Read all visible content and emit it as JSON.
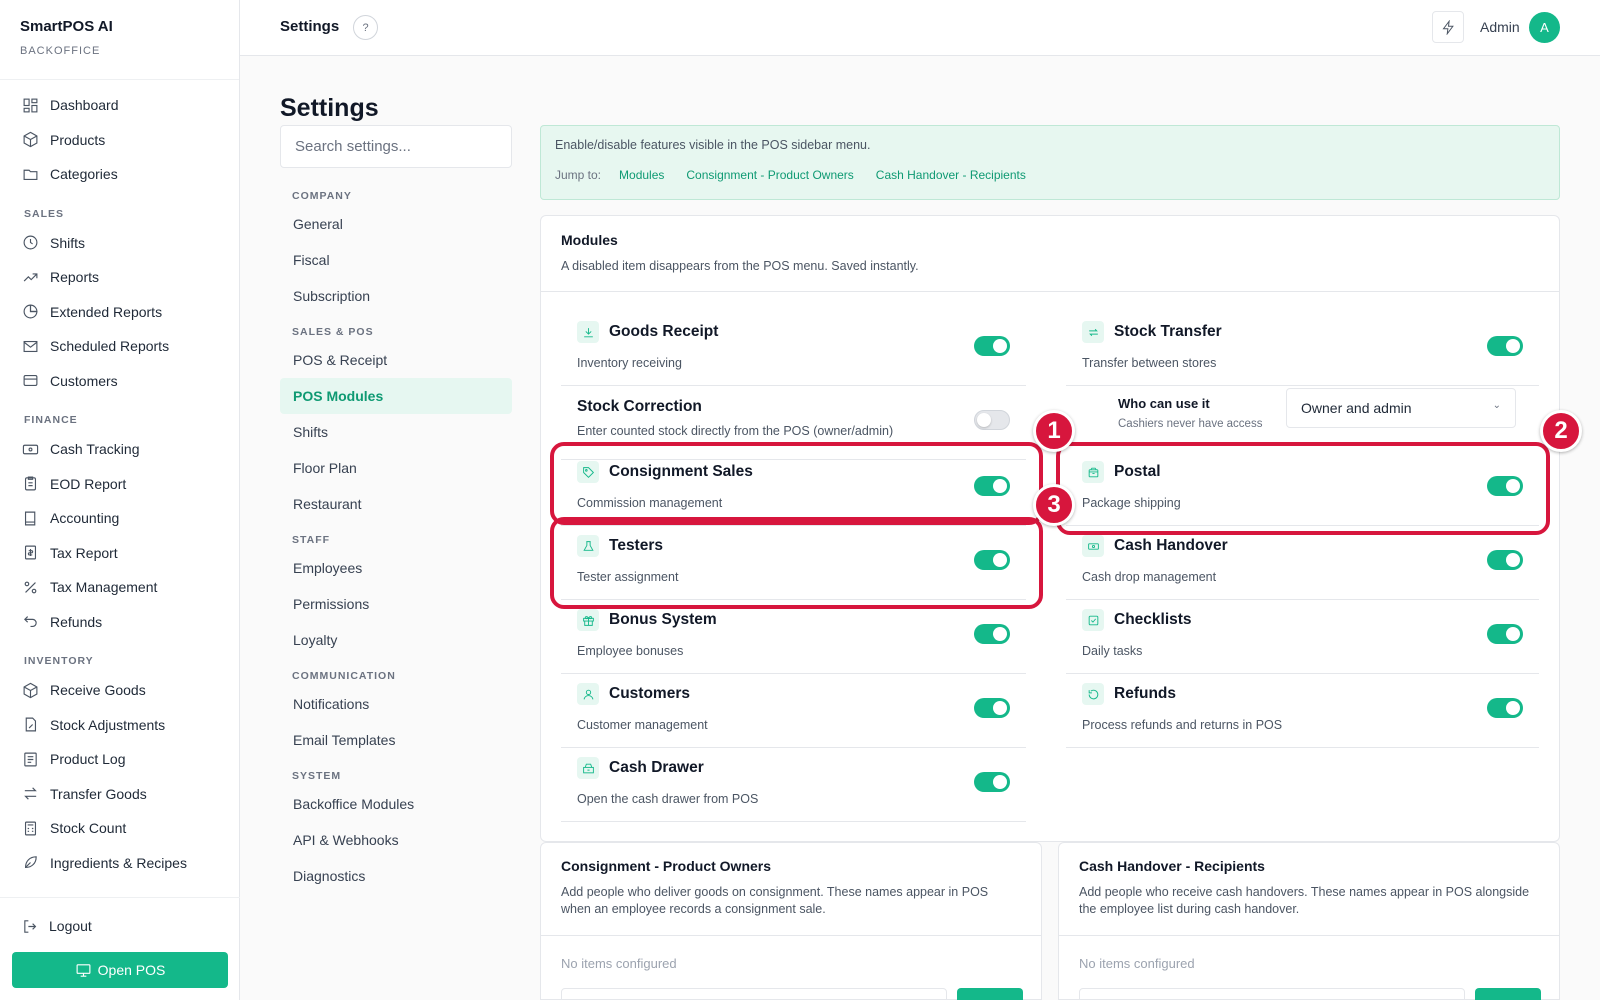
{
  "brand": {
    "name": "SmartPOS AI",
    "sub": "BACKOFFICE"
  },
  "nav": {
    "top": [
      "Dashboard",
      "Products",
      "Categories"
    ],
    "sales_title": "SALES",
    "sales": [
      "Shifts",
      "Reports",
      "Extended Reports",
      "Scheduled Reports",
      "Customers"
    ],
    "finance_title": "FINANCE",
    "finance": [
      "Cash Tracking",
      "EOD Report",
      "Accounting",
      "Tax Report",
      "Tax Management",
      "Refunds"
    ],
    "inventory_title": "INVENTORY",
    "inventory": [
      "Receive Goods",
      "Stock Adjustments",
      "Product Log",
      "Transfer Goods",
      "Stock Count",
      "Ingredients & Recipes"
    ],
    "logout": "Logout",
    "open_pos": "Open POS"
  },
  "topbar": {
    "title": "Settings",
    "help": "?",
    "user": "Admin",
    "avatar": "A"
  },
  "settings": {
    "title": "Settings",
    "search_placeholder": "Search settings...",
    "company_title": "COMPANY",
    "company": [
      "General",
      "Fiscal",
      "Subscription"
    ],
    "sales_pos_title": "SALES & POS",
    "sales_pos": [
      "POS & Receipt",
      "POS Modules",
      "Shifts",
      "Floor Plan",
      "Restaurant"
    ],
    "staff_title": "STAFF",
    "staff": [
      "Employees",
      "Permissions",
      "Loyalty"
    ],
    "communication_title": "COMMUNICATION",
    "communication": [
      "Notifications",
      "Email Templates"
    ],
    "system_title": "SYSTEM",
    "system": [
      "Backoffice Modules",
      "API & Webhooks",
      "Diagnostics"
    ]
  },
  "banner": {
    "text": "Enable/disable features visible in the POS sidebar menu.",
    "jump_label": "Jump to:",
    "links": [
      "Modules",
      "Consignment - Product Owners",
      "Cash Handover - Recipients"
    ]
  },
  "modules": {
    "title": "Modules",
    "subtitle": "A disabled item disappears from the POS menu. Saved instantly.",
    "left": [
      {
        "title": "Goods Receipt",
        "desc": "Inventory receiving",
        "icon": "download-icon",
        "on": true
      },
      {
        "title": "Stock Correction",
        "desc": "Enter counted stock directly from the POS (owner/admin)",
        "icon": "",
        "on": false
      },
      {
        "title": "Consignment Sales",
        "desc": "Commission management",
        "icon": "tag-icon",
        "on": true
      },
      {
        "title": "Testers",
        "desc": "Tester assignment",
        "icon": "flask-icon",
        "on": true
      },
      {
        "title": "Bonus System",
        "desc": "Employee bonuses",
        "icon": "gift-icon",
        "on": true
      },
      {
        "title": "Customers",
        "desc": "Customer management",
        "icon": "user-icon",
        "on": true
      },
      {
        "title": "Cash Drawer",
        "desc": "Open the cash drawer from POS",
        "icon": "drawer-icon",
        "on": true
      }
    ],
    "right": [
      {
        "title": "Stock Transfer",
        "desc": "Transfer between stores",
        "icon": "transfer-icon",
        "on": true
      },
      {
        "title": "Postal",
        "desc": "Package shipping",
        "icon": "package-icon",
        "on": true
      },
      {
        "title": "Cash Handover",
        "desc": "Cash drop management",
        "icon": "cash-icon",
        "on": true
      },
      {
        "title": "Checklists",
        "desc": "Daily tasks",
        "icon": "checklist-icon",
        "on": true
      },
      {
        "title": "Refunds",
        "desc": "Process refunds and returns in POS",
        "icon": "refund-icon",
        "on": true
      }
    ],
    "who": {
      "label": "Who can use it",
      "desc": "Cashiers never have access",
      "value": "Owner and admin"
    }
  },
  "consignment": {
    "title": "Consignment - Product Owners",
    "desc": "Add people who deliver goods on consignment. These names appear in POS when an employee records a consignment sale.",
    "empty": "No items configured"
  },
  "handover": {
    "title": "Cash Handover - Recipients",
    "desc": "Add people who receive cash handovers. These names appear in POS alongside the employee list during cash handover.",
    "empty": "No items configured"
  },
  "annotations": [
    "1",
    "2",
    "3"
  ],
  "colors": {
    "accent": "#14b88a",
    "annotation": "#d7163d",
    "banner_bg": "#e7f7f0"
  }
}
